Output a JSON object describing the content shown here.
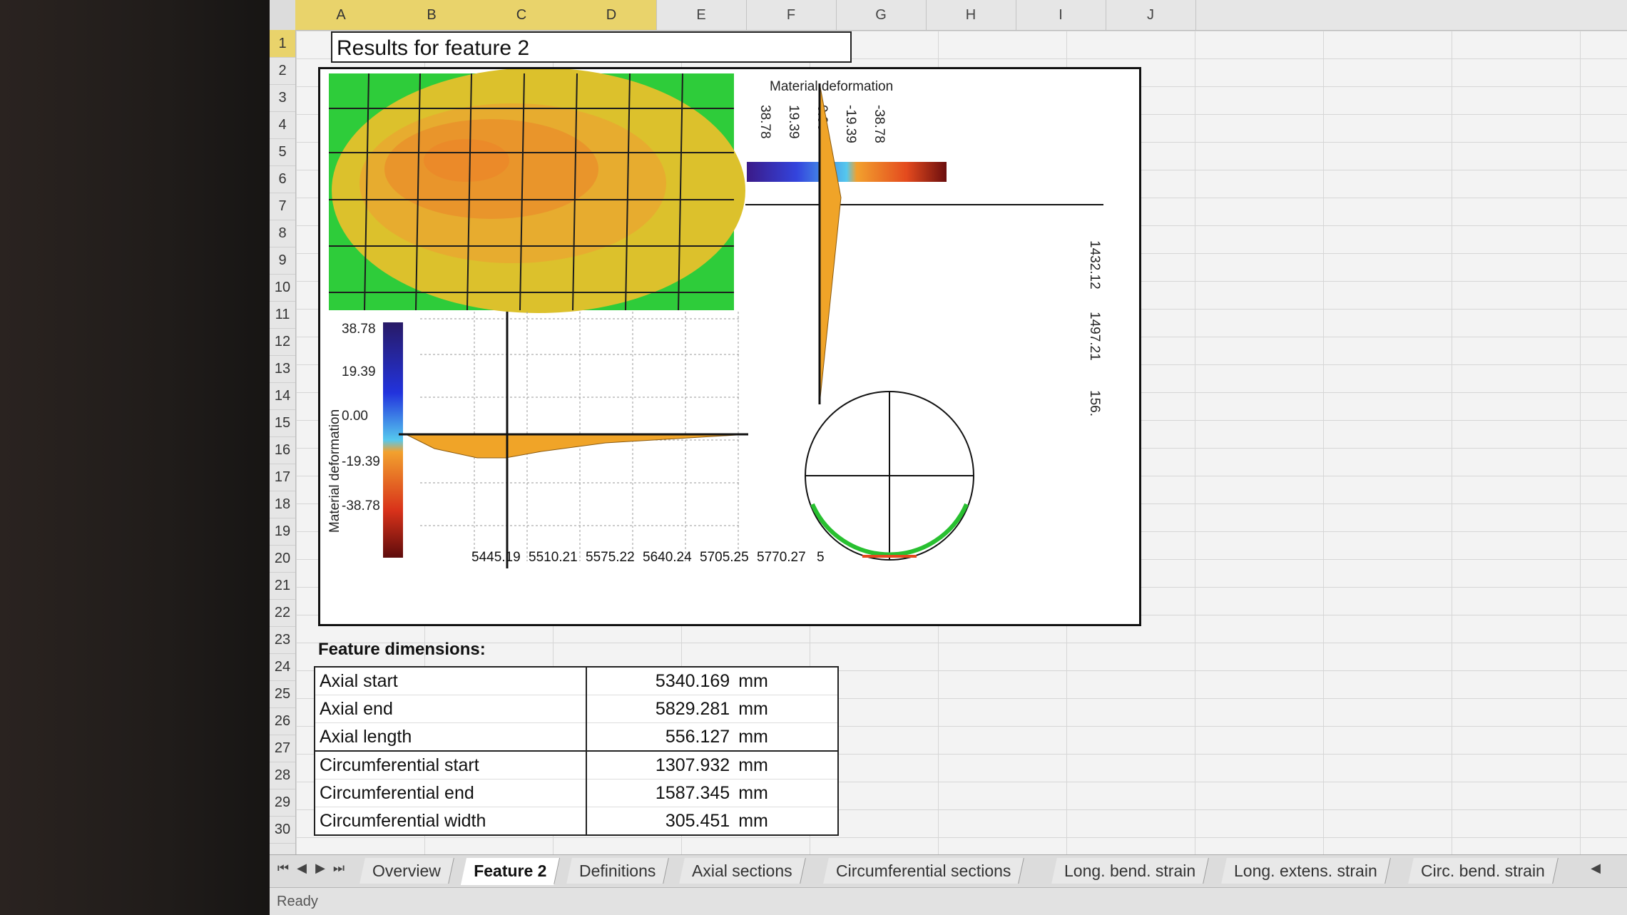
{
  "columns": [
    "A",
    "B",
    "C",
    "D",
    "E",
    "F",
    "G",
    "H",
    "I",
    "J"
  ],
  "rows": [
    "1",
    "2",
    "3",
    "4",
    "5",
    "6",
    "7",
    "8",
    "9",
    "10",
    "11",
    "12",
    "13",
    "14",
    "15",
    "16",
    "17",
    "18",
    "19",
    "20",
    "21",
    "22",
    "23",
    "24",
    "25",
    "26",
    "27",
    "28",
    "29",
    "30"
  ],
  "sheet_title": "Results for feature 2",
  "chart": {
    "legend_title": "Material deformation",
    "legend_vertical_label": "Material deformation",
    "top_scale": [
      "38.78",
      "19.39",
      "0.00",
      "-19.39",
      "-38.78"
    ],
    "right_axis": [
      "1432.12",
      "1497.21",
      "156."
    ],
    "left_scale": [
      "38.78",
      "19.39",
      "0.00",
      "-19.39",
      "-38.78"
    ],
    "x_axis": [
      "5445.19",
      "5510.21",
      "5575.22",
      "5640.24",
      "5705.25",
      "5770.27"
    ],
    "x_axis_trailing": "5"
  },
  "dimensions": {
    "title": "Feature dimensions:",
    "rows": [
      {
        "label": "Axial start",
        "value": "5340.169",
        "unit": "mm"
      },
      {
        "label": "Axial end",
        "value": "5829.281",
        "unit": "mm"
      },
      {
        "label": "Axial length",
        "value": "556.127",
        "unit": "mm"
      },
      {
        "label": "Circumferential start",
        "value": "1307.932",
        "unit": "mm"
      },
      {
        "label": "Circumferential end",
        "value": "1587.345",
        "unit": "mm"
      },
      {
        "label": "Circumferential width",
        "value": "305.451",
        "unit": "mm"
      }
    ]
  },
  "tabs": [
    "Overview",
    "Feature 2",
    "Definitions",
    "Axial sections",
    "Circumferential sections",
    "Long. bend. strain",
    "Long. extens. strain",
    "Circ. bend. strain"
  ],
  "active_tab": "Feature 2",
  "status": "Ready",
  "colors": {
    "selected_header": "#e9d36b",
    "green": "#2ecc3a",
    "yellow": "#e5c530",
    "orange": "#e9a22e"
  }
}
